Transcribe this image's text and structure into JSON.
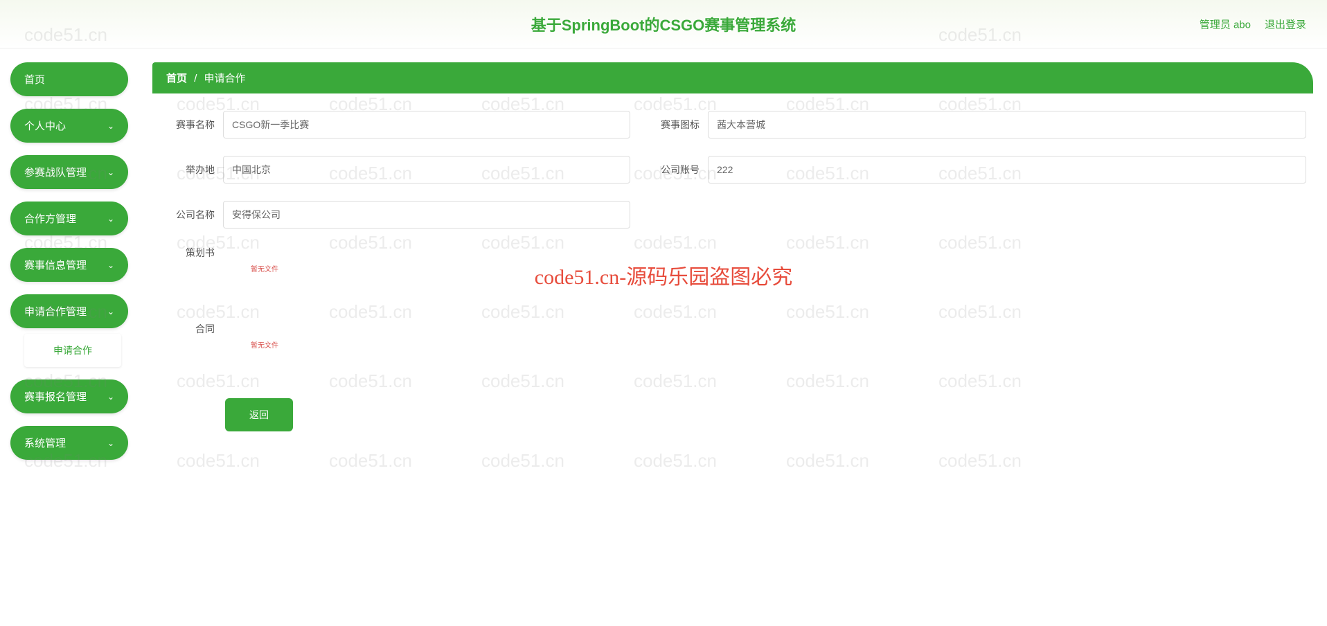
{
  "header": {
    "title": "基于SpringBoot的CSGO赛事管理系统",
    "user_label": "管理员 abo",
    "logout": "退出登录"
  },
  "sidebar": {
    "home": "首页",
    "personal": "个人中心",
    "team_mgmt": "参赛战队管理",
    "partner_mgmt": "合作方管理",
    "match_info_mgmt": "赛事信息管理",
    "apply_mgmt": "申请合作管理",
    "apply_sub": "申请合作",
    "signup_mgmt": "赛事报名管理",
    "system_mgmt": "系统管理"
  },
  "breadcrumb": {
    "home": "首页",
    "sep": "/",
    "current": "申请合作"
  },
  "form": {
    "labels": {
      "match_name": "赛事名称",
      "match_icon": "赛事图标",
      "location": "举办地",
      "company_account": "公司账号",
      "company_name": "公司名称",
      "proposal": "策划书",
      "contract": "合同"
    },
    "values": {
      "match_name": "CSGO新一季比赛",
      "match_icon": "茜大本营城",
      "location": "中国北京",
      "company_account": "222",
      "company_name": "安得保公司"
    },
    "file_placeholder": "暂无文件",
    "back_button": "返回"
  },
  "watermark": {
    "text": "code51.cn",
    "center": "code51.cn-源码乐园盗图必究"
  }
}
